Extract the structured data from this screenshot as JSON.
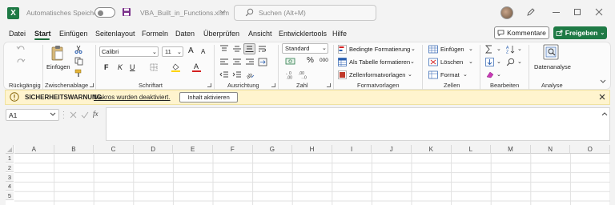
{
  "titlebar": {
    "autosave_label": "Automatisches Speichern",
    "filename": "VBA_Built_in_Functions.xlsm",
    "search_placeholder": "Suchen (Alt+M)"
  },
  "tabs": [
    "Datei",
    "Start",
    "Einfügen",
    "Seitenlayout",
    "Formeln",
    "Daten",
    "Überprüfen",
    "Ansicht",
    "Entwicklertools",
    "Hilfe"
  ],
  "active_tab": "Start",
  "actions": {
    "comments": "Kommentare",
    "share": "Freigeben"
  },
  "ribbon": {
    "clipboard": {
      "paste": "Einfügen"
    },
    "font": {
      "name": "Calibri",
      "size": "11",
      "bold": "F",
      "italic": "K",
      "underline": "U",
      "grow": "A",
      "shrink": "A"
    },
    "number": {
      "format": "Allgemein_label_hidden",
      "format_display": "Standard",
      "percent": "%",
      "thousands": "000"
    },
    "styles": {
      "cond": "Bedingte Formatierung",
      "table": "Als Tabelle formatieren",
      "cell": "Zellenformatvorlagen"
    },
    "cells": {
      "insert": "Einfügen",
      "delete": "Löschen",
      "format": "Format"
    },
    "analysis": {
      "data_analysis": "Datenanalyse"
    },
    "groups": [
      "Rückgängig",
      "Zwischenablage",
      "Schriftart",
      "Ausrichtung",
      "Zahl",
      "Formatvorlagen",
      "Zellen",
      "Bearbeiten",
      "Analyse"
    ]
  },
  "security": {
    "title": "SICHERHEITSWARNUNG",
    "message": "Makros wurden deaktiviert.",
    "button": "Inhalt aktivieren"
  },
  "formula": {
    "namebox": "A1",
    "fx": "fx",
    "value": ""
  },
  "grid": {
    "columns": [
      "A",
      "B",
      "C",
      "D",
      "E",
      "F",
      "G",
      "H",
      "I",
      "J",
      "K",
      "L",
      "M",
      "N",
      "O"
    ],
    "rows": [
      "1",
      "2",
      "3",
      "4",
      "5"
    ]
  },
  "colors": {
    "accent": "#1e7a45",
    "warning_bg": "#fff4ce"
  }
}
